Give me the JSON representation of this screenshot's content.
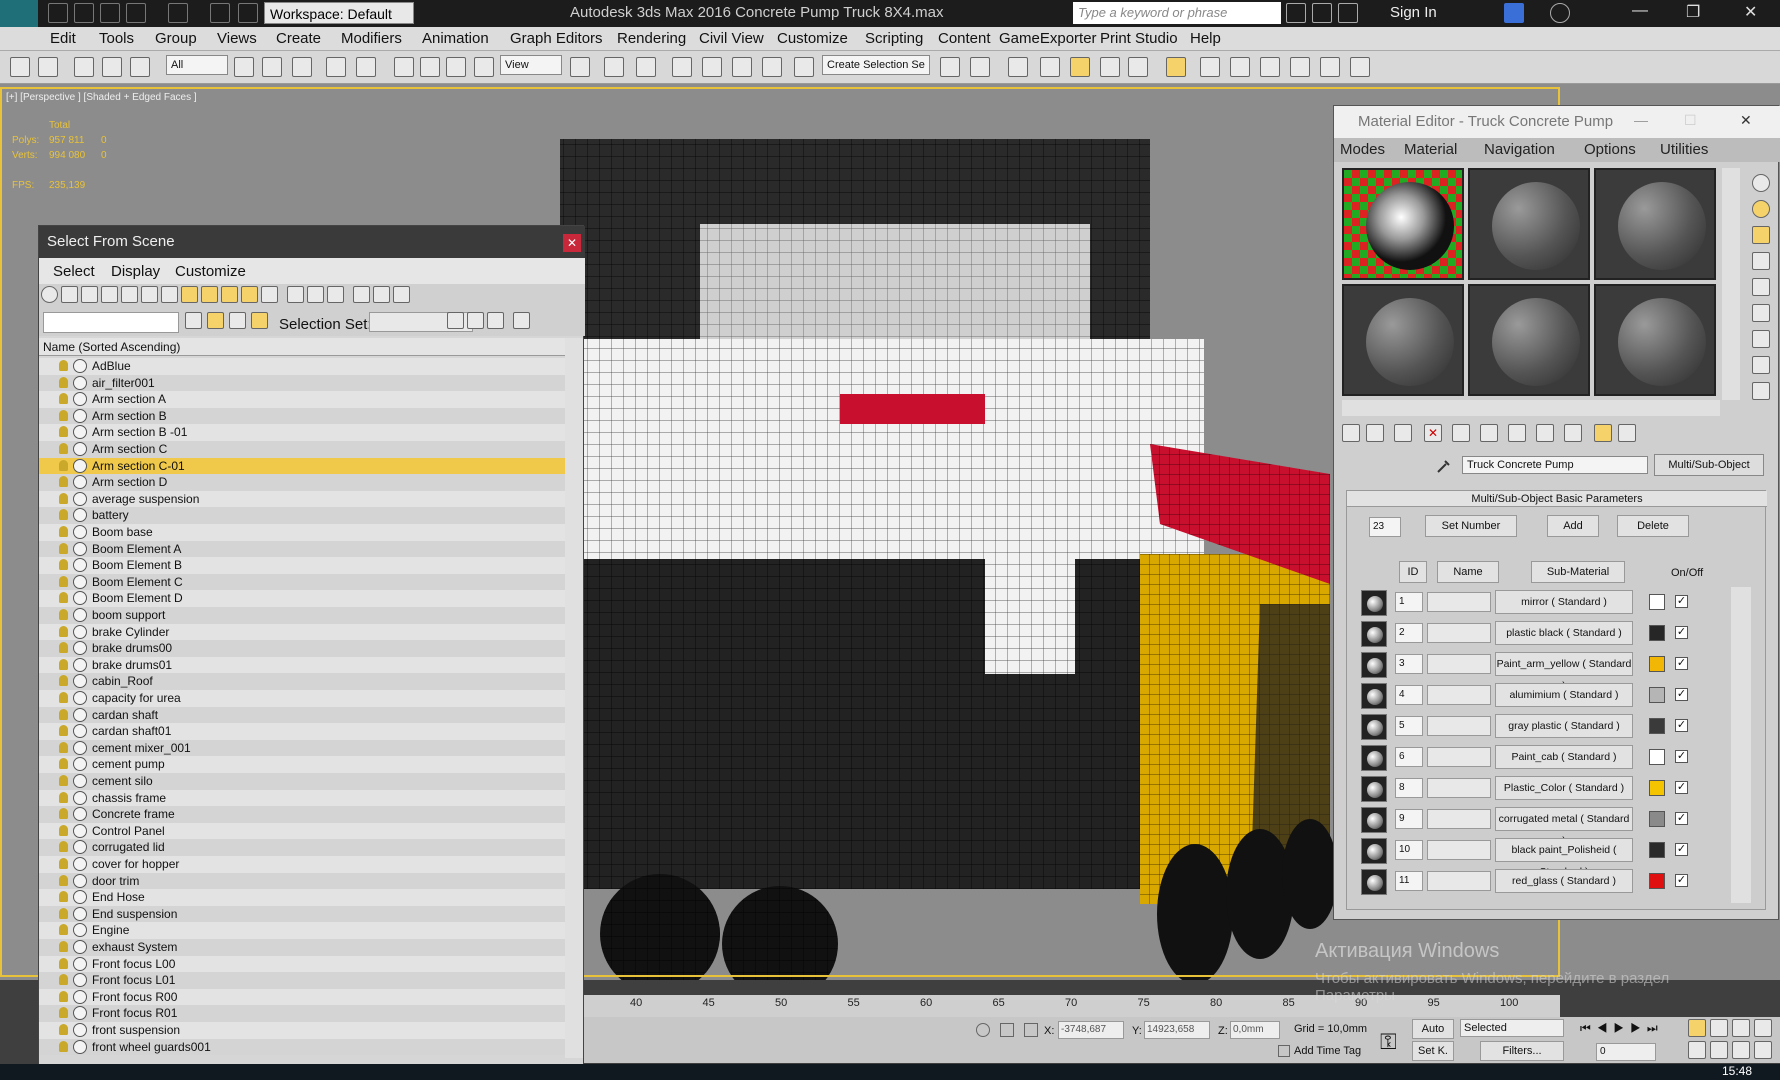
{
  "titlebar": {
    "workspace": "Workspace: Default",
    "title": "Autodesk 3ds Max 2016    Concrete Pump Truck 8X4.max",
    "search_placeholder": "Type a keyword or phrase",
    "sign_in": "Sign In"
  },
  "menubar": [
    "Edit",
    "Tools",
    "Group",
    "Views",
    "Create",
    "Modifiers",
    "Animation",
    "Graph Editors",
    "Rendering",
    "Civil View",
    "Customize",
    "Scripting",
    "Content",
    "GameExporter",
    "Print Studio",
    "Help"
  ],
  "toolbar": {
    "filter": "All",
    "ref_coord": "View",
    "selection_set": "Create Selection Se"
  },
  "viewport": {
    "label": "[+] [Perspective ] [Shaded + Edged Faces ]",
    "stats": {
      "total_label": "Total",
      "polys_label": "Polys:",
      "polys": "957 811",
      "polys_sel": "0",
      "verts_label": "Verts:",
      "verts": "994 080",
      "verts_sel": "0",
      "fps_label": "FPS:",
      "fps": "235,139"
    }
  },
  "select_from_scene": {
    "title": "Select From Scene",
    "menu": [
      "Select",
      "Display",
      "Customize"
    ],
    "selection_set_label": "Selection Set:",
    "column_header": "Name (Sorted Ascending)",
    "selected_index": 6,
    "items": [
      "AdBlue",
      "air_filter001",
      "Arm section A",
      "Arm section B",
      "Arm section B -01",
      "Arm section C",
      "Arm section C-01",
      "Arm section D",
      "average suspension",
      "battery",
      "Boom base",
      "Boom Element A",
      "Boom Element B",
      "Boom Element C",
      "Boom Element D",
      "boom support",
      "brake Cylinder",
      "brake drums00",
      "brake drums01",
      "cabin_Roof",
      "capacity for urea",
      "cardan shaft",
      "cardan shaft01",
      "cement mixer_001",
      "cement pump",
      "cement silo",
      "chassis frame",
      "Concrete frame",
      "Control Panel",
      "corrugated lid",
      "cover for hopper",
      "door trim",
      "End Hose",
      "End suspension",
      "Engine",
      "exhaust System",
      "Front focus L00",
      "Front focus L01",
      "Front focus R00",
      "Front focus R01",
      "front suspension",
      "front wheel guards001"
    ]
  },
  "material_editor": {
    "title": "Material Editor - Truck Concrete Pump",
    "menu": [
      "Modes",
      "Material",
      "Navigation",
      "Options",
      "Utilities"
    ],
    "material_name": "Truck Concrete Pump",
    "material_type": "Multi/Sub-Object",
    "panel_title": "Multi/Sub-Object Basic Parameters",
    "count": "23",
    "buttons": {
      "set_number": "Set Number",
      "add": "Add",
      "delete": "Delete"
    },
    "columns": {
      "id": "ID",
      "name": "Name",
      "sub": "Sub-Material",
      "onoff": "On/Off"
    },
    "rows": [
      {
        "id": "1",
        "sub": "mirror  ( Standard )",
        "swatch": "#ffffff"
      },
      {
        "id": "2",
        "sub": "plastic black  ( Standard )",
        "swatch": "#262626"
      },
      {
        "id": "3",
        "sub": "Paint_arm_yellow  ( Standard )",
        "swatch": "#f2b705"
      },
      {
        "id": "4",
        "sub": "alumimium  ( Standard )",
        "swatch": "#b5b5b5"
      },
      {
        "id": "5",
        "sub": "gray plastic  ( Standard )",
        "swatch": "#3a3a3a"
      },
      {
        "id": "6",
        "sub": "Paint_cab  ( Standard )",
        "swatch": "#ffffff"
      },
      {
        "id": "8",
        "sub": "Plastic_Color  ( Standard )",
        "swatch": "#f5c400"
      },
      {
        "id": "9",
        "sub": "corrugated metal  ( Standard )",
        "swatch": "#8a8a8a"
      },
      {
        "id": "10",
        "sub": "black paint_Polisheid  ( Standard )",
        "swatch": "#2a2a2a"
      },
      {
        "id": "11",
        "sub": "red_glass  ( Standard )",
        "swatch": "#e01010"
      }
    ]
  },
  "timeline": {
    "ticks": [
      "40",
      "45",
      "50",
      "55",
      "60",
      "65",
      "70",
      "75",
      "80",
      "85",
      "90",
      "95",
      "100"
    ]
  },
  "status": {
    "x_label": "X:",
    "x": "-3748,687",
    "y_label": "Y:",
    "y": "14923,658",
    "z_label": "Z:",
    "z": "0,0mm",
    "grid": "Grid = 10,0mm",
    "add_time_tag": "Add Time Tag",
    "auto": "Auto",
    "set_k": "Set K.",
    "selected": "Selected",
    "filters": "Filters...",
    "frame": "0"
  },
  "watermark": {
    "line1": "Активация Windows",
    "line2": "Чтобы активировать Windows, перейдите в раздел",
    "line3": "Параметры"
  },
  "clock": "15:48",
  "colors": {
    "accent_yellow": "#f0c94a",
    "truck_red": "#c8102e",
    "truck_yellow": "#e3b000"
  }
}
